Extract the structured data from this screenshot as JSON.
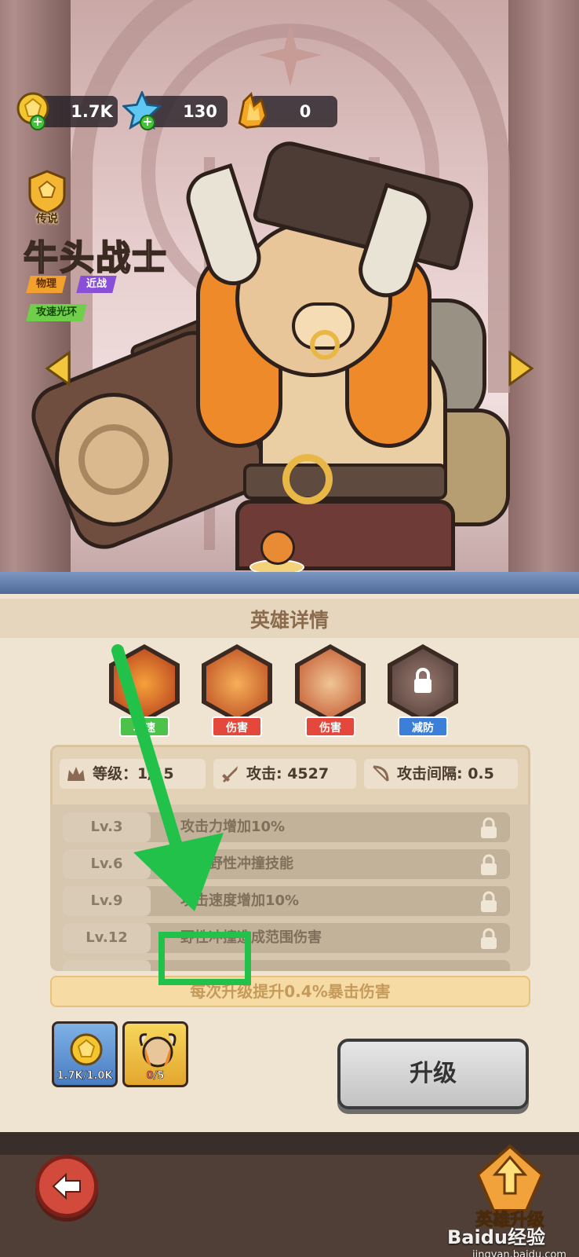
{
  "currency": {
    "gold": "1.7K",
    "gems": "130",
    "crystals": "0"
  },
  "hero": {
    "rarity": "传说",
    "name": "牛头战士",
    "tags": [
      "物理",
      "近战",
      "攻速光环"
    ]
  },
  "panel": {
    "title": "英雄详情",
    "skills": [
      {
        "label": "攻速",
        "color": "#4cc24a"
      },
      {
        "label": "伤害",
        "color": "#e4473c"
      },
      {
        "label": "伤害",
        "color": "#e4473c"
      },
      {
        "label": "减防",
        "color": "#3b7fd8"
      }
    ],
    "stats": {
      "level": "等级：1/15",
      "attack": "攻击: 4527",
      "interval": "攻击间隔: 0.5"
    },
    "unlocks": [
      {
        "level": "Lv.3",
        "text": "攻击力增加10%"
      },
      {
        "level": "Lv.6",
        "text": "解锁野性冲撞技能"
      },
      {
        "level": "Lv.9",
        "text": "攻击速度增加10%"
      },
      {
        "level": "Lv.12",
        "text": "野性冲撞造成范围伤害"
      }
    ],
    "bonus": "每次升级提升0.4%暴击伤害",
    "cost_gold": "1.7K/1.0K",
    "cost_shards_have": "0",
    "cost_shards_need": "/5",
    "upgrade_label": "升级"
  },
  "bottom": {
    "upgrade_tab_label": "英雄升级"
  },
  "watermark": {
    "brand": "Baidu经验",
    "url": "jingyan.baidu.com"
  },
  "colors": {
    "annotation": "#22c24a"
  }
}
